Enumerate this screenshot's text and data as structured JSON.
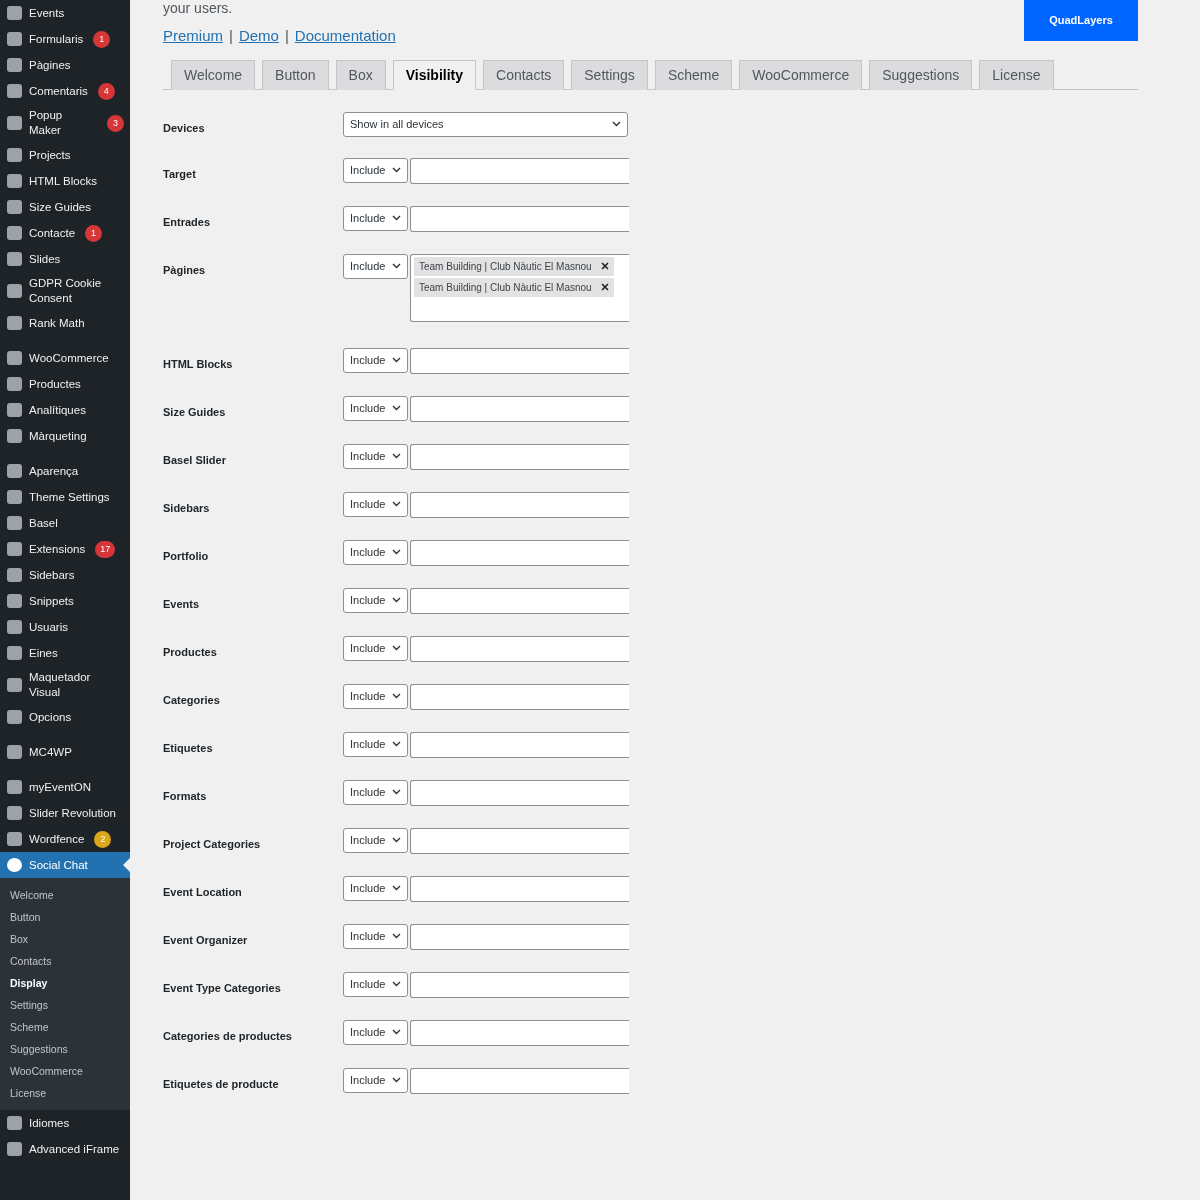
{
  "sidebar": {
    "items": [
      {
        "label": "Events",
        "selected": false
      },
      {
        "label": "Formularis",
        "selected": false,
        "badge": {
          "text": "1",
          "color": "#d63638"
        }
      },
      {
        "label": "Pàgines",
        "selected": false
      },
      {
        "label": "Comentaris",
        "selected": false,
        "badge": {
          "text": "4",
          "color": "#d63638"
        }
      },
      {
        "label": "Popup Maker",
        "selected": false,
        "badge": {
          "text": "3",
          "color": "#d63638"
        }
      },
      {
        "label": "Projects",
        "selected": false
      },
      {
        "label": "HTML Blocks",
        "selected": false
      },
      {
        "label": "Size Guides",
        "selected": false
      },
      {
        "label": "Contacte",
        "selected": false,
        "badge": {
          "text": "1",
          "color": "#d63638"
        }
      },
      {
        "label": "Slides",
        "selected": false
      },
      {
        "label": "GDPR Cookie Consent",
        "selected": false
      },
      {
        "label": "Rank Math",
        "selected": false
      },
      {
        "kind": "separator"
      },
      {
        "label": "WooCommerce",
        "selected": false
      },
      {
        "label": "Productes",
        "selected": false
      },
      {
        "label": "Analítiques",
        "selected": false
      },
      {
        "label": "Màrqueting",
        "selected": false
      },
      {
        "kind": "separator"
      },
      {
        "label": "Aparença",
        "selected": false
      },
      {
        "label": "Theme Settings",
        "selected": false
      },
      {
        "label": "Basel",
        "selected": false
      },
      {
        "label": "Extensions",
        "selected": false,
        "badge": {
          "text": "17",
          "color": "#d63638"
        }
      },
      {
        "label": "Sidebars",
        "selected": false
      },
      {
        "label": "Snippets",
        "selected": false
      },
      {
        "label": "Usuaris",
        "selected": false
      },
      {
        "label": "Eines",
        "selected": false
      },
      {
        "label": "Maquetador Visual",
        "selected": false
      },
      {
        "label": "Opcions",
        "selected": false
      },
      {
        "kind": "separator"
      },
      {
        "label": "MC4WP",
        "selected": false
      },
      {
        "kind": "separator"
      },
      {
        "label": "myEventON",
        "selected": false
      },
      {
        "label": "Slider Revolution",
        "selected": false
      },
      {
        "label": "Wordfence",
        "selected": false,
        "badge": {
          "text": "2",
          "color": "#dba617"
        }
      },
      {
        "label": "Social Chat",
        "selected": true,
        "children": [
          {
            "label": "Welcome",
            "selected": false
          },
          {
            "label": "Button",
            "selected": false
          },
          {
            "label": "Box",
            "selected": false
          },
          {
            "label": "Contacts",
            "selected": false
          },
          {
            "label": "Display",
            "selected": true
          },
          {
            "label": "Settings",
            "selected": false
          },
          {
            "label": "Scheme",
            "selected": false
          },
          {
            "label": "Suggestions",
            "selected": false
          },
          {
            "label": "WooCommerce",
            "selected": false
          },
          {
            "label": "License",
            "selected": false
          }
        ]
      },
      {
        "label": "Idiomes",
        "selected": false
      },
      {
        "label": "Advanced iFrame",
        "selected": false
      }
    ]
  },
  "intro": "your users.",
  "links": [
    "Premium",
    "Demo",
    "Documentation"
  ],
  "link_separators": [
    "|",
    "|"
  ],
  "brand_button": "QuadLayers",
  "tabs": [
    {
      "label": "Welcome",
      "selected": false
    },
    {
      "label": "Button",
      "selected": false
    },
    {
      "label": "Box",
      "selected": false
    },
    {
      "label": "Visibility",
      "selected": true
    },
    {
      "label": "Contacts",
      "selected": false
    },
    {
      "label": "Settings",
      "selected": false
    },
    {
      "label": "Scheme",
      "selected": false
    },
    {
      "label": "WooCommerce",
      "selected": false
    },
    {
      "label": "Suggestions",
      "selected": false
    },
    {
      "label": "License",
      "selected": false
    }
  ],
  "rows": [
    {
      "label": "Devices",
      "kind": "select",
      "value": "Show in all devices"
    },
    {
      "label": "Target",
      "kind": "include",
      "value": "Include"
    },
    {
      "label": "Entrades",
      "kind": "include",
      "value": "Include"
    },
    {
      "label": "Pàgines",
      "kind": "include",
      "value": "Include",
      "tags": [
        "Team Building | Club Nàutic El Masnou",
        "Team Building | Club Nàutic El Masnou"
      ]
    },
    {
      "label": "HTML Blocks",
      "kind": "include",
      "value": "Include"
    },
    {
      "label": "Size Guides",
      "kind": "include",
      "value": "Include"
    },
    {
      "label": "Basel Slider",
      "kind": "include",
      "value": "Include"
    },
    {
      "label": "Sidebars",
      "kind": "include",
      "value": "Include"
    },
    {
      "label": "Portfolio",
      "kind": "include",
      "value": "Include"
    },
    {
      "label": "Events",
      "kind": "include",
      "value": "Include"
    },
    {
      "label": "Productes",
      "kind": "include",
      "value": "Include"
    },
    {
      "label": "Categories",
      "kind": "include",
      "value": "Include"
    },
    {
      "label": "Etiquetes",
      "kind": "include",
      "value": "Include"
    },
    {
      "label": "Formats",
      "kind": "include",
      "value": "Include"
    },
    {
      "label": "Project Categories",
      "kind": "include",
      "value": "Include"
    },
    {
      "label": "Event Location",
      "kind": "include",
      "value": "Include"
    },
    {
      "label": "Event Organizer",
      "kind": "include",
      "value": "Include"
    },
    {
      "label": "Event Type Categories",
      "kind": "include",
      "value": "Include"
    },
    {
      "label": "Categories de productes",
      "kind": "include",
      "value": "Include"
    },
    {
      "label": "Etiquetes de producte",
      "kind": "include",
      "value": "Include"
    }
  ]
}
